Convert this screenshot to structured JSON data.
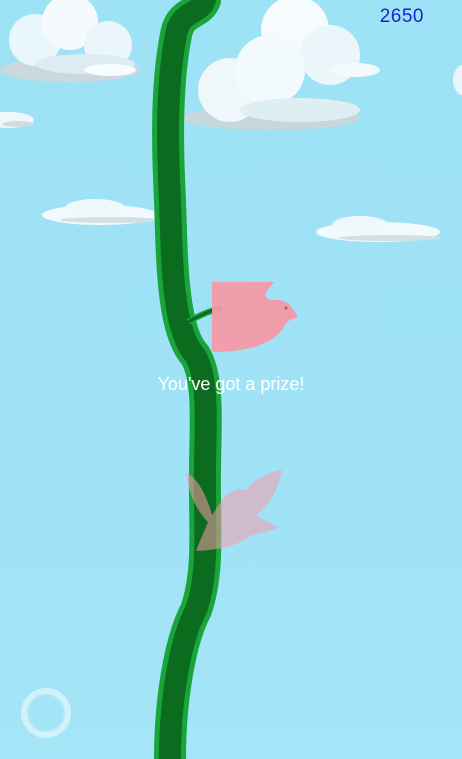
{
  "hud": {
    "score": "2650"
  },
  "message": {
    "prize_text": "You've got a prize!"
  },
  "icons": {
    "joystick": "circle-joystick-icon",
    "bird": "dove-icon"
  },
  "colors": {
    "sky": "#9ee3f6",
    "beanstalk": "#0b6b1f",
    "beanstalk_outline": "#1aa53a",
    "bird": "#f59aa8",
    "score": "#1a20d6"
  }
}
